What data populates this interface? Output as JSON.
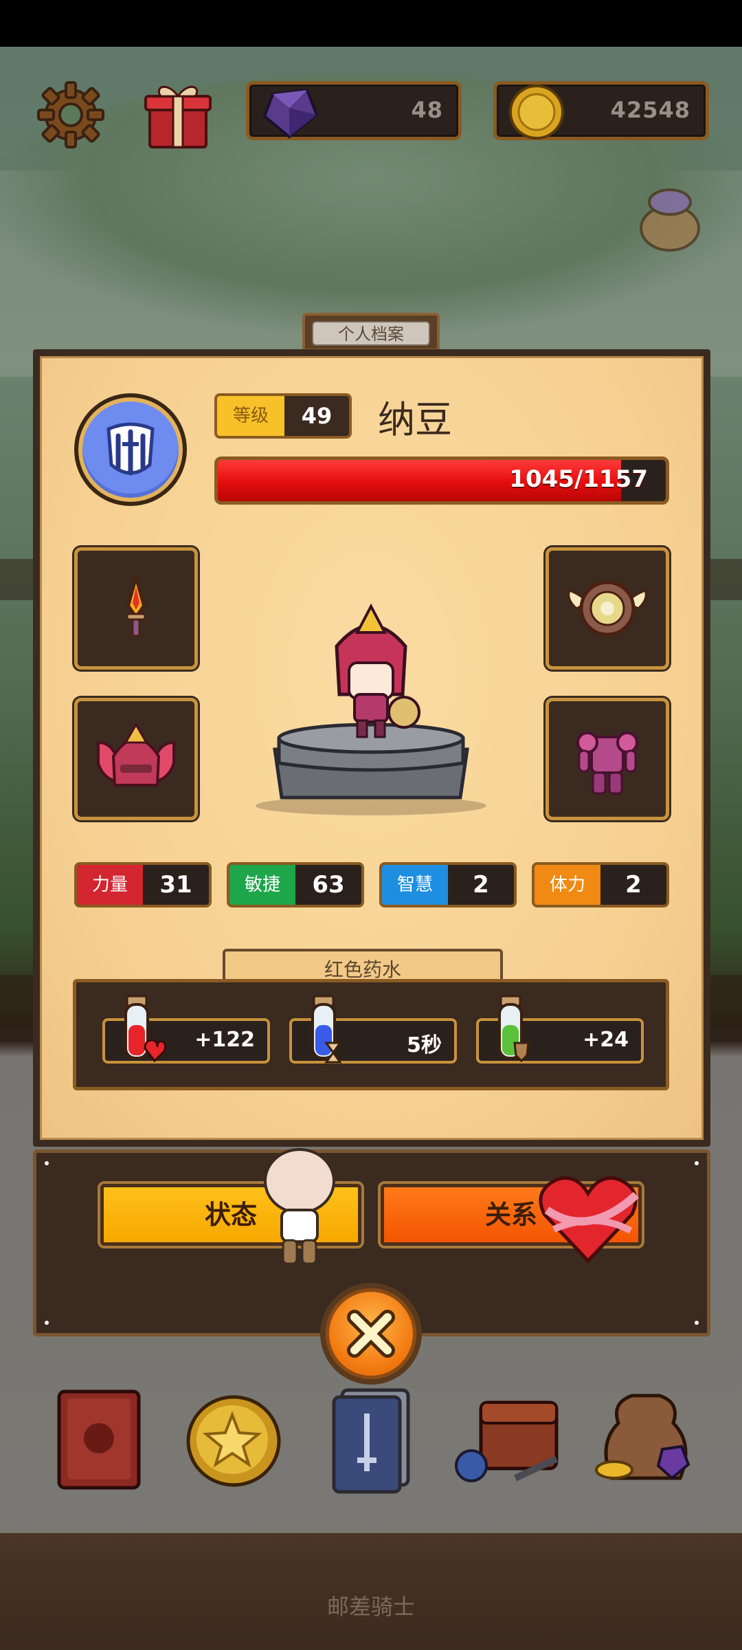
{
  "top_bar": {
    "gems": "48",
    "coins": "42548"
  },
  "profile": {
    "tab_label": "个人档案",
    "level_label": "等级",
    "level": "49",
    "name": "纳豆",
    "hp_text": "1045/1157",
    "hp_fraction": 0.9
  },
  "stats": [
    {
      "label": "力量",
      "value": "31",
      "color": "#d32630"
    },
    {
      "label": "敏捷",
      "value": "63",
      "color": "#1ea64a"
    },
    {
      "label": "智慧",
      "value": "2",
      "color": "#1e8fe0"
    },
    {
      "label": "体力",
      "value": "2",
      "color": "#f08a12"
    }
  ],
  "potion": {
    "title": "红色药水",
    "items": [
      {
        "value": "+122"
      },
      {
        "value": "5秒"
      },
      {
        "value": "+24"
      }
    ]
  },
  "buttons": {
    "status": "状态",
    "relation": "关系"
  },
  "footer": {
    "title": "邮差骑士"
  }
}
